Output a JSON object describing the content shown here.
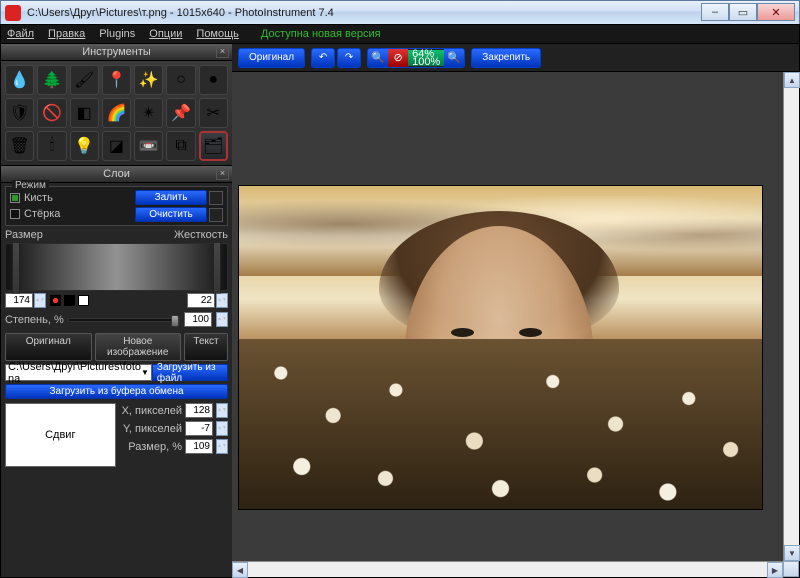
{
  "window": {
    "title": "C:\\Users\\Друг\\Pictures\\т.png  -  1015x640  -  PhotoInstrument 7.4"
  },
  "menubar": {
    "file": "Файл",
    "edit": "Правка",
    "plugins": "Plugins",
    "options": "Опции",
    "help": "Помощь",
    "update": "Доступна новая версия"
  },
  "panels": {
    "tools_title": "Инструменты",
    "layers_title": "Слои"
  },
  "tools": [
    {
      "name": "droplet",
      "glyph": "💧"
    },
    {
      "name": "tree",
      "glyph": "🌲"
    },
    {
      "name": "brush",
      "glyph": "🖌"
    },
    {
      "name": "stamp",
      "glyph": "📍"
    },
    {
      "name": "glow",
      "glyph": "✨"
    },
    {
      "name": "dodge",
      "glyph": "○"
    },
    {
      "name": "burn",
      "glyph": "●"
    },
    {
      "name": "shield",
      "glyph": "🛡"
    },
    {
      "name": "nosign",
      "glyph": "🚫"
    },
    {
      "name": "gradient-bw",
      "glyph": "◧"
    },
    {
      "name": "gradient-color",
      "glyph": "🌈"
    },
    {
      "name": "wand",
      "glyph": "✴"
    },
    {
      "name": "pin",
      "glyph": "📌"
    },
    {
      "name": "scissors",
      "glyph": "✂"
    },
    {
      "name": "trash",
      "glyph": "🗑"
    },
    {
      "name": "candle",
      "glyph": "🕯"
    },
    {
      "name": "bulb",
      "glyph": "💡"
    },
    {
      "name": "eraser",
      "glyph": "◪"
    },
    {
      "name": "tape",
      "glyph": "📼"
    },
    {
      "name": "overlap",
      "glyph": "⧉"
    },
    {
      "name": "layers-tool",
      "glyph": "🗂",
      "selected": true
    }
  ],
  "mode": {
    "label": "Режим",
    "brush": "Кисть",
    "eraser": "Стёрка",
    "brush_checked": true,
    "eraser_checked": false,
    "fill_btn": "Залить",
    "clear_btn": "Очистить"
  },
  "sliders": {
    "size_label": "Размер",
    "hardness_label": "Жесткость",
    "size_value": "174",
    "hardness_value": "22",
    "degree_label": "Степень, %",
    "degree_value": "100"
  },
  "tabs": {
    "original": "Оригинал",
    "newimage": "Новое изображение",
    "text": "Текст"
  },
  "file": {
    "path": "C:\\Users\\Друг\\Pictures\\foto na",
    "load_file": "Загрузить из файл",
    "load_clipboard": "Загрузить из буфера обмена"
  },
  "offset": {
    "shift_label": "Сдвиг",
    "x_label": "X, пикселей",
    "y_label": "Y, пикселей",
    "size_label": "Размер, %",
    "x": "128",
    "y": "-7",
    "size": "109"
  },
  "toolbar": {
    "original": "Оригинал",
    "undo_icon": "↶",
    "redo_icon": "↷",
    "zoom_top": "64%",
    "zoom_bottom": "100%",
    "fix": "Закрепить"
  }
}
